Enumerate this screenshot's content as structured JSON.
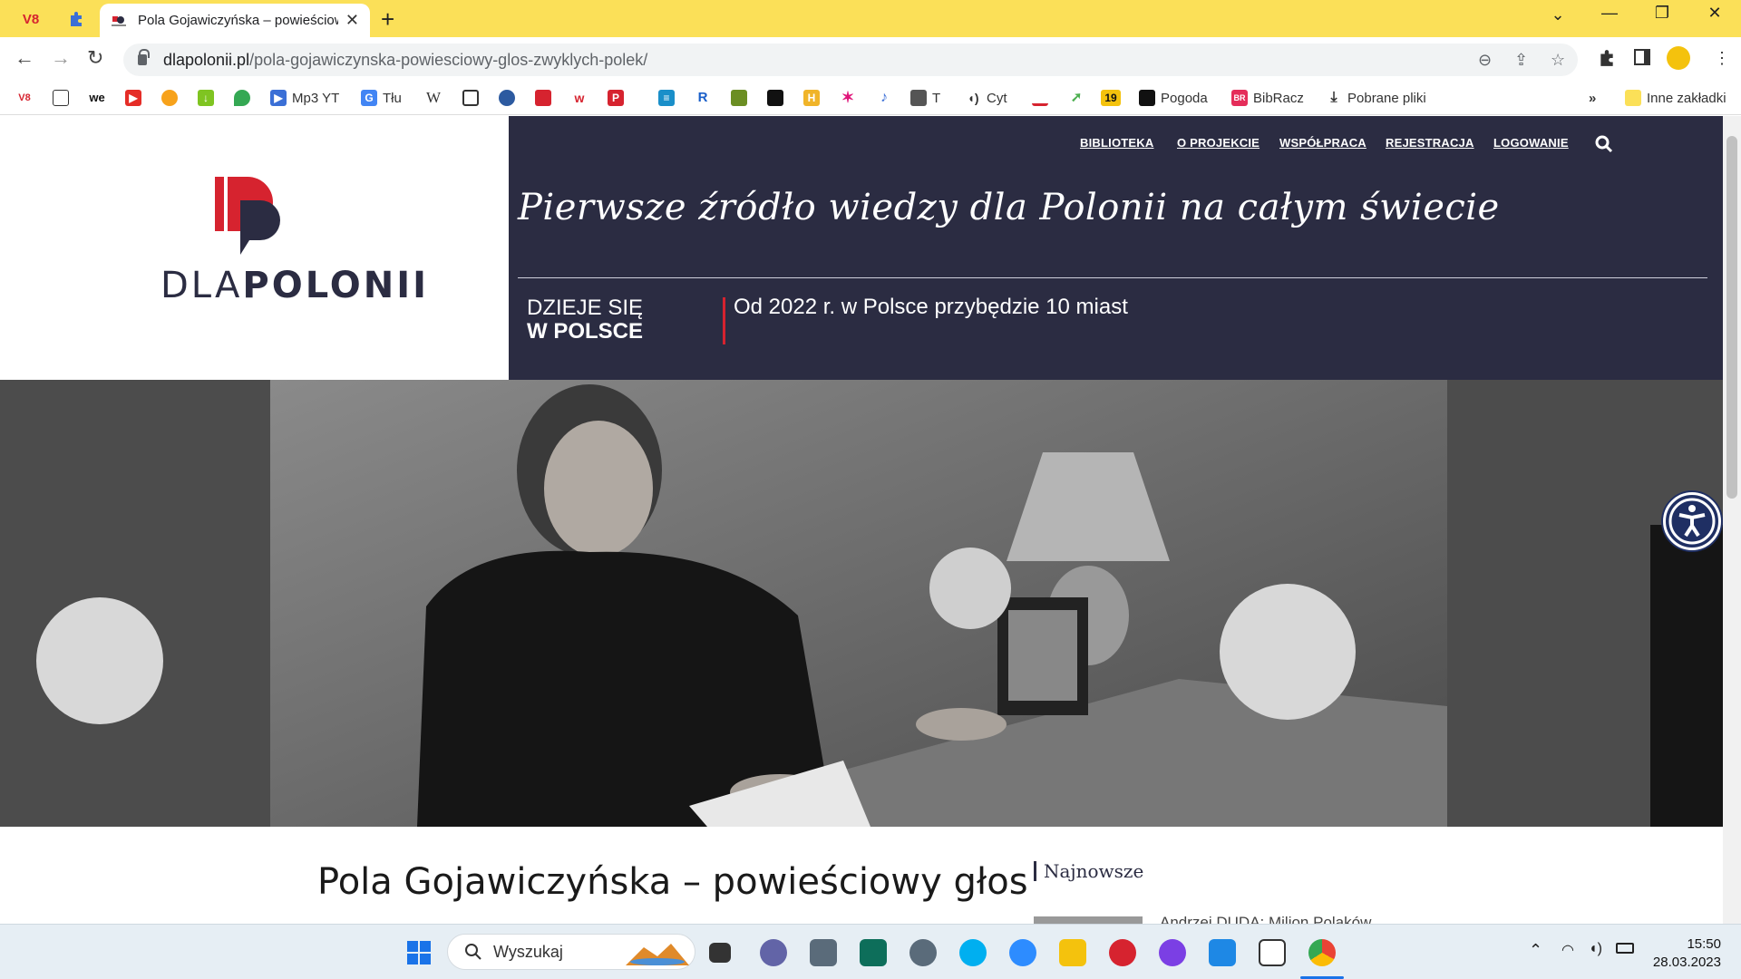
{
  "browser": {
    "tab_title": "Pola Gojawiczyńska – powieściow",
    "url_domain": "dlapolonii.pl",
    "url_path": "/pola-gojawiczynska-powiesciowy-glos-zwyklych-polek/",
    "pinned_tab_1": "V8",
    "bookmarks": [
      {
        "label": "Mp3 YT"
      },
      {
        "label": "Tłu"
      },
      {
        "label": "W"
      },
      {
        "label": "T"
      },
      {
        "label": "Cyt"
      },
      {
        "label": "19"
      },
      {
        "label": "Pogoda"
      },
      {
        "label": "BibRacz"
      },
      {
        "label": "Pobrane pliki"
      },
      {
        "label": "Inne zakładki"
      }
    ],
    "bookmark_overflow": "»"
  },
  "site": {
    "logo_text_light": "DLA",
    "logo_text_bold": "POLONII",
    "nav": [
      "BIBLIOTEKA",
      "O PROJEKCIE",
      "WSPÓŁPRACA",
      "REJESTRACJA",
      "LOGOWANIE"
    ],
    "tagline": "Pierwsze źródło wiedzy dla Polonii na całym świecie",
    "ticker_label_1": "DZIEJE SIĘ",
    "ticker_label_2": "W POLSCE",
    "ticker_news": "Od 2022 r. w Polsce przybędzie 10 miast",
    "article_title": "Pola Gojawiczyńska – powieściowy głos",
    "sidebar_heading": "Najnowsze",
    "sidebar_item": "Andrzej DUDA: Milion Polaków"
  },
  "taskbar": {
    "search_label": "Wyszukaj",
    "time": "15:50",
    "date": "28.03.2023"
  },
  "colors": {
    "header_navy": "#2b2c42",
    "accent_red": "#d6232f",
    "chrome_yellow": "#fbe058"
  }
}
